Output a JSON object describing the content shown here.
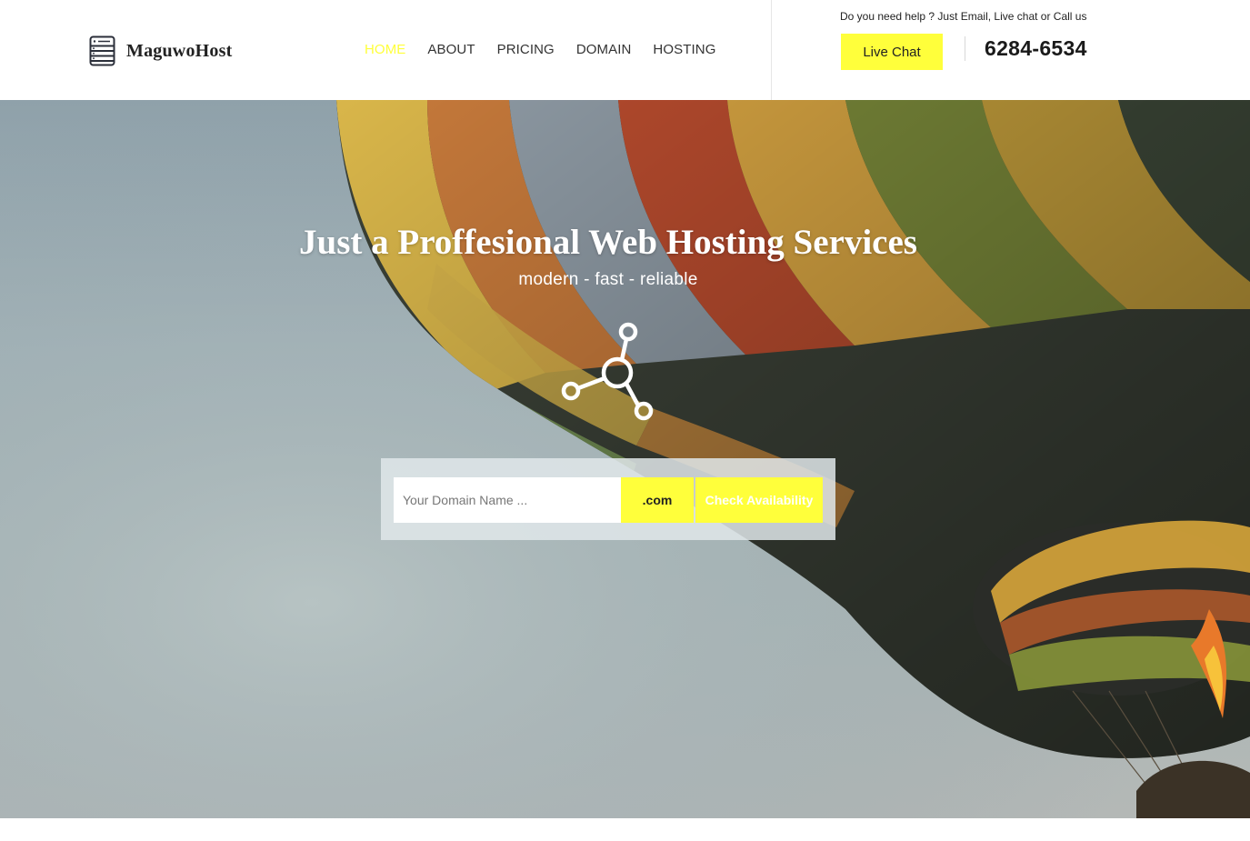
{
  "brand": {
    "name": "MaguwoHost",
    "logo_icon": "server-icon"
  },
  "nav": {
    "items": [
      {
        "label": "HOME",
        "active": true
      },
      {
        "label": "ABOUT",
        "active": false
      },
      {
        "label": "PRICING",
        "active": false
      },
      {
        "label": "DOMAIN",
        "active": false
      },
      {
        "label": "HOSTING",
        "active": false
      }
    ]
  },
  "contact": {
    "help_text": "Do you need help ? Just Email, Live chat or Call us",
    "live_chat_label": "Live Chat",
    "phone": "6284-6534"
  },
  "hero": {
    "title": "Just a Proffesional Web Hosting Services",
    "subtitle": "modern - fast - reliable",
    "icon": "network-nodes-icon",
    "background_image": "hot-air-balloon-photo"
  },
  "domain_search": {
    "placeholder": "Your Domain Name ...",
    "value": "",
    "tld_label": ".com",
    "check_label": "Check Availability"
  },
  "colors": {
    "accent": "#ffff3b",
    "text_dark": "#222222",
    "white": "#ffffff"
  }
}
